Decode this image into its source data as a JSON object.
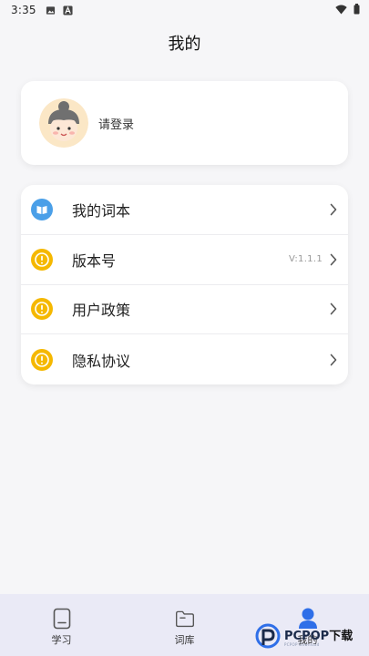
{
  "status_bar": {
    "time": "3:35",
    "left_icons": [
      "image-icon",
      "a-letter-icon"
    ],
    "right_icons": [
      "wifi-icon",
      "battery-icon"
    ]
  },
  "header": {
    "title": "我的"
  },
  "profile": {
    "login_label": "请登录",
    "avatar_icon": "avatar-icon"
  },
  "menu": {
    "items": [
      {
        "label": "我的词本",
        "icon": "book-icon",
        "icon_color": "#4a9fe8",
        "value": ""
      },
      {
        "label": "版本号",
        "icon": "info-circle-icon",
        "icon_color": "#f5b800",
        "value": "V:1.1.1"
      },
      {
        "label": "用户政策",
        "icon": "info-circle-icon",
        "icon_color": "#f5b800",
        "value": ""
      },
      {
        "label": "隐私协议",
        "icon": "info-circle-icon",
        "icon_color": "#f5b800",
        "value": ""
      }
    ]
  },
  "tabbar": {
    "tabs": [
      {
        "label": "学习",
        "icon": "study-icon",
        "active": false
      },
      {
        "label": "词库",
        "icon": "folder-icon",
        "active": false
      },
      {
        "label": "我的",
        "icon": "profile-icon",
        "active": true
      }
    ]
  },
  "watermark": {
    "brand": "PCPOP",
    "suffix": "下载",
    "tagline": "PCPOP Download"
  },
  "colors": {
    "accent_blue": "#2f6fe8",
    "icon_yellow": "#f5b800",
    "icon_blue": "#4a9fe8",
    "tabbar_bg": "#eaeaf6"
  }
}
